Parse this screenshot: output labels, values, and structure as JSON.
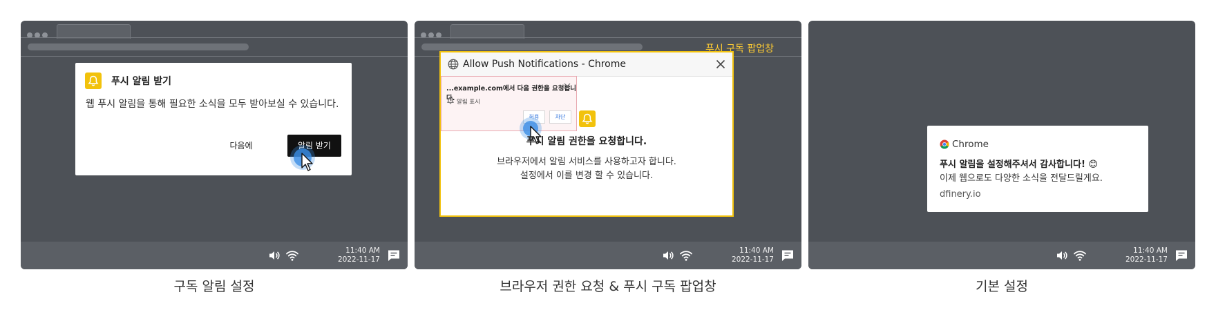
{
  "panels": [
    {
      "dialog": {
        "title": "푸시 알림 받기",
        "description": "웹 푸시 알림을 통해 필요한 소식을 모두 받아보실 수 있습니다.",
        "later_label": "다음에",
        "accept_label": "알림 받기"
      },
      "clock": {
        "time": "11:40 AM",
        "date": "2022-11-17"
      },
      "caption": "구독 알림 설정"
    },
    {
      "popup_label": "푸시 구독 팝업창",
      "window": {
        "title": "Allow Push Notifications - Chrome",
        "permission": {
          "title": "...example.com에서 다음 권한을 요청합니다.",
          "item": "알림 표시",
          "allow_label": "허용",
          "block_label": "차단"
        },
        "heading": "푸시 알림 권한을 요청합니다.",
        "line1": "브라우저에서 알림 서비스를 사용하고자 합니다.",
        "line2": "설정에서 이를 변경 할 수 있습니다."
      },
      "clock": {
        "time": "11:40 AM",
        "date": "2022-11-17"
      },
      "caption": "브라우저 권한 요청 & 푸시 구독 팝업창"
    },
    {
      "notification": {
        "app": "Chrome",
        "title": "푸시 알림을 설정해주셔서 감사합니다! 😊",
        "body": "이제 웹으로도 다양한 소식을 전달드릴게요.",
        "site": "dfinery.io"
      },
      "clock": {
        "time": "11:40 AM",
        "date": "2022-11-17"
      },
      "caption": "기본 설정"
    }
  ],
  "colors": {
    "accent_yellow": "#f2c20c",
    "desktop_gray": "#4d5157",
    "taskbar_gray": "#5b5f65"
  },
  "icons": [
    "bell-icon",
    "globe-icon",
    "close-icon",
    "cursor-icon",
    "volume-icon",
    "wifi-icon",
    "chat-icon",
    "chrome-logo-icon"
  ]
}
